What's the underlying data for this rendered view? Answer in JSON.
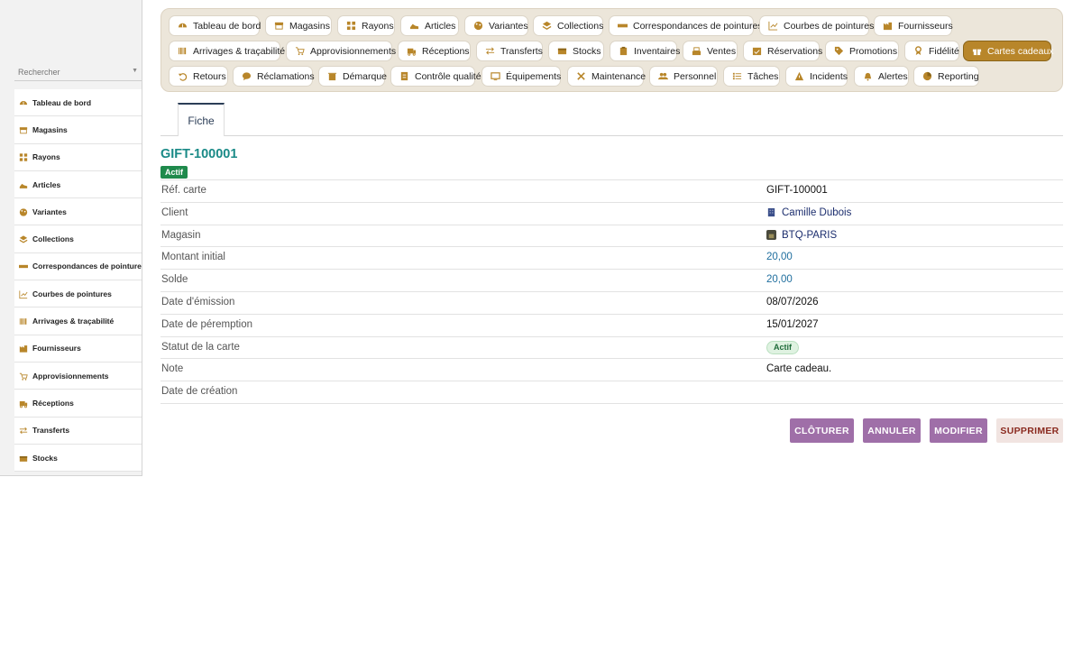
{
  "colors": {
    "accent": "#b8862a",
    "title_teal": "#1a8a87",
    "button_purple": "#9f6fa8",
    "status_green": "#1f8a4c"
  },
  "sidebar": {
    "search_placeholder": "Rechercher",
    "items": [
      {
        "label": "Tableau de bord",
        "icon": "dashboard-icon"
      },
      {
        "label": "Magasins",
        "icon": "store-icon"
      },
      {
        "label": "Rayons",
        "icon": "grid-icon"
      },
      {
        "label": "Articles",
        "icon": "shoe-icon"
      },
      {
        "label": "Variantes",
        "icon": "palette-icon"
      },
      {
        "label": "Collections",
        "icon": "layers-icon"
      },
      {
        "label": "Correspondances de pointures",
        "icon": "ruler-icon"
      },
      {
        "label": "Courbes de pointures",
        "icon": "chart-icon"
      },
      {
        "label": "Arrivages & traçabilité",
        "icon": "barcode-icon"
      },
      {
        "label": "Fournisseurs",
        "icon": "factory-icon"
      },
      {
        "label": "Approvisionnements",
        "icon": "cart-icon"
      },
      {
        "label": "Réceptions",
        "icon": "truck-icon"
      },
      {
        "label": "Transferts",
        "icon": "exchange-icon"
      },
      {
        "label": "Stocks",
        "icon": "box-icon"
      }
    ]
  },
  "topnav": {
    "rows": [
      [
        {
          "label": "Tableau de bord",
          "icon": "dashboard-icon"
        },
        {
          "label": "Magasins",
          "icon": "store-icon"
        },
        {
          "label": "Rayons",
          "icon": "grid-icon"
        },
        {
          "label": "Articles",
          "icon": "shoe-icon"
        },
        {
          "label": "Variantes",
          "icon": "palette-icon"
        },
        {
          "label": "Collections",
          "icon": "layers-icon"
        },
        {
          "label": "Correspondances de pointures",
          "icon": "ruler-icon"
        },
        {
          "label": "Courbes de pointures",
          "icon": "chart-icon"
        },
        {
          "label": "Fournisseurs",
          "icon": "factory-icon"
        }
      ],
      [
        {
          "label": "Arrivages & traçabilité",
          "icon": "barcode-icon"
        },
        {
          "label": "Approvisionnements",
          "icon": "cart-icon"
        },
        {
          "label": "Réceptions",
          "icon": "truck-icon"
        },
        {
          "label": "Transferts",
          "icon": "exchange-icon"
        },
        {
          "label": "Stocks",
          "icon": "box-icon"
        },
        {
          "label": "Inventaires",
          "icon": "clipboard-icon"
        },
        {
          "label": "Ventes",
          "icon": "cashier-icon"
        },
        {
          "label": "Réservations",
          "icon": "calendar-check-icon"
        },
        {
          "label": "Promotions",
          "icon": "tag-icon"
        },
        {
          "label": "Fidélité",
          "icon": "award-icon"
        },
        {
          "label": "Cartes cadeaux",
          "icon": "gift-icon",
          "active": true
        }
      ],
      [
        {
          "label": "Retours",
          "icon": "undo-icon"
        },
        {
          "label": "Réclamations",
          "icon": "comment-icon"
        },
        {
          "label": "Démarque",
          "icon": "trash-icon"
        },
        {
          "label": "Contrôle qualité",
          "icon": "checklist-icon"
        },
        {
          "label": "Équipements",
          "icon": "monitor-icon"
        },
        {
          "label": "Maintenance",
          "icon": "tools-icon"
        },
        {
          "label": "Personnel",
          "icon": "users-icon"
        },
        {
          "label": "Tâches",
          "icon": "tasks-icon"
        },
        {
          "label": "Incidents",
          "icon": "warning-icon"
        },
        {
          "label": "Alertes",
          "icon": "bell-icon"
        },
        {
          "label": "Reporting",
          "icon": "pie-icon"
        }
      ]
    ]
  },
  "tabs": {
    "fiche": "Fiche"
  },
  "record": {
    "title": "GIFT-100001",
    "status_badge": "Actif",
    "fields": [
      {
        "label": "Réf. carte",
        "value": "GIFT-100001",
        "kind": "text"
      },
      {
        "label": "Client",
        "value": "Camille Dubois",
        "kind": "link",
        "icon": "building-icon"
      },
      {
        "label": "Magasin",
        "value": "BTQ-PARIS",
        "kind": "link",
        "icon": "store-thumb-icon"
      },
      {
        "label": "Montant initial",
        "value": "20,00",
        "kind": "num"
      },
      {
        "label": "Solde",
        "value": "20,00",
        "kind": "num"
      },
      {
        "label": "Date d'émission",
        "value": "08/07/2026",
        "kind": "text"
      },
      {
        "label": "Date de péremption",
        "value": "15/01/2027",
        "kind": "text"
      },
      {
        "label": "Statut de la carte",
        "value": "Actif",
        "kind": "pill"
      },
      {
        "label": "Note",
        "value": "Carte cadeau.",
        "kind": "text"
      },
      {
        "label": "Date de création",
        "value": "",
        "kind": "text"
      }
    ]
  },
  "actions": {
    "close": "CLÔTURER",
    "cancel": "ANNULER",
    "edit": "MODIFIER",
    "delete": "SUPPRIMER"
  }
}
